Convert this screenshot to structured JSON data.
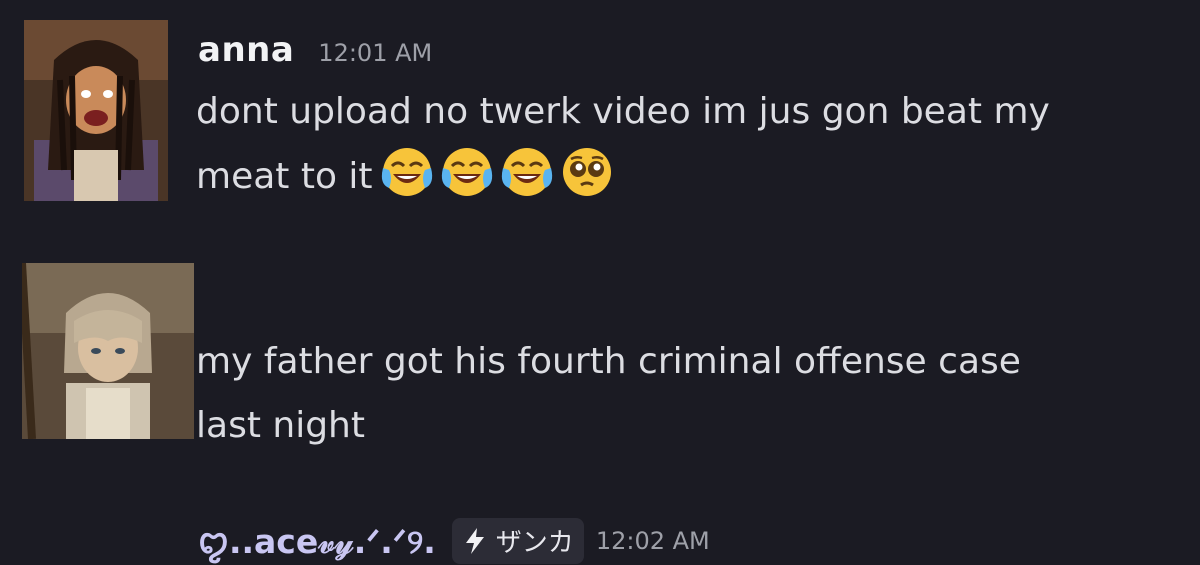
{
  "messages": [
    {
      "username": "anna",
      "timestamp": "12:01 AM",
      "lines": [
        "dont upload no twerk video im jus gon beat my",
        "meat to it"
      ],
      "emojis": [
        "face-with-tears-of-joy-icon",
        "face-with-tears-of-joy-icon",
        "face-with-tears-of-joy-icon",
        "pleading-face-icon"
      ]
    },
    {
      "username": "ꨄ︎..ace𝓋𝓎.ᐟ.ᐟ୨.",
      "tag": "ザンカ",
      "tag_icon": "lightning-bolt-icon",
      "timestamp": "12:02 AM",
      "lines": [
        "my father got his fourth criminal offense case",
        "last night"
      ]
    }
  ],
  "colors": {
    "background": "#1b1b23",
    "username": "#f2f3f5",
    "timestamp": "#9ea0a8",
    "message_text": "#dcdde2",
    "fancy_username": "#c9c6f2",
    "tag_background": "#2c2c36"
  }
}
